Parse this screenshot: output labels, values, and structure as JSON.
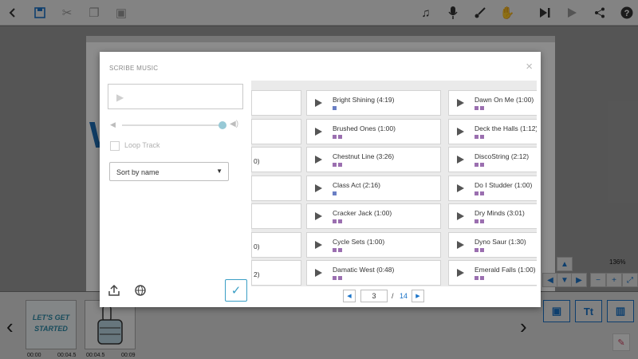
{
  "toolbar": {
    "icons": [
      "back-icon",
      "save-icon",
      "cut-icon",
      "copy-icon",
      "paste-icon",
      "music-icon",
      "mic-icon",
      "brush-icon",
      "hand-icon",
      "play-skip-icon",
      "play-icon",
      "share-icon",
      "help-icon"
    ]
  },
  "canvas": {
    "letter": "W",
    "zoom": "136%"
  },
  "timeline": {
    "thumb1_text": "LET'S GET STARTED",
    "thumb1_time_a": "00:00",
    "thumb1_time_b": "00:04.5",
    "thumb2_time_a": "00:04.5",
    "thumb2_time_b": "00:09",
    "text_tool": "Tt"
  },
  "dialog": {
    "title": "SCRIBE MUSIC",
    "close": "×",
    "loop_label": "Loop Track",
    "sort_value": "Sort by name",
    "confirm": "✓"
  },
  "colors": {
    "accent": "#1a73c8",
    "sq_purple": "#9b6fb0",
    "sq_blue": "#6a7fc4"
  },
  "tracks": {
    "col_left_partial": [
      "",
      "",
      "0)",
      "",
      "",
      "0)",
      "2)"
    ],
    "col_mid": [
      {
        "name": "Bright Shining (4:19)",
        "bars": 1
      },
      {
        "name": "Brushed Ones (1:00)",
        "bars": 2
      },
      {
        "name": "Chestnut Line (3:26)",
        "bars": 2
      },
      {
        "name": "Class Act (2:16)",
        "bars": 1
      },
      {
        "name": "Cracker Jack (1:00)",
        "bars": 2
      },
      {
        "name": "Cycle Sets (1:00)",
        "bars": 2
      },
      {
        "name": "Damatic West (0:48)",
        "bars": 2
      }
    ],
    "col_right": [
      {
        "name": "Dawn On Me (1:00)",
        "bars": 2
      },
      {
        "name": "Deck the Halls (1:12)",
        "bars": 2
      },
      {
        "name": "DiscoString (2:12)",
        "bars": 2
      },
      {
        "name": "Do I Studder (1:00)",
        "bars": 2
      },
      {
        "name": "Dry Minds (3:01)",
        "bars": 2
      },
      {
        "name": "Dyno Saur (1:30)",
        "bars": 2
      },
      {
        "name": "Emerald Falls (1:00)",
        "bars": 2
      }
    ]
  },
  "pager": {
    "current": "3",
    "separator": "/",
    "total": "14"
  }
}
